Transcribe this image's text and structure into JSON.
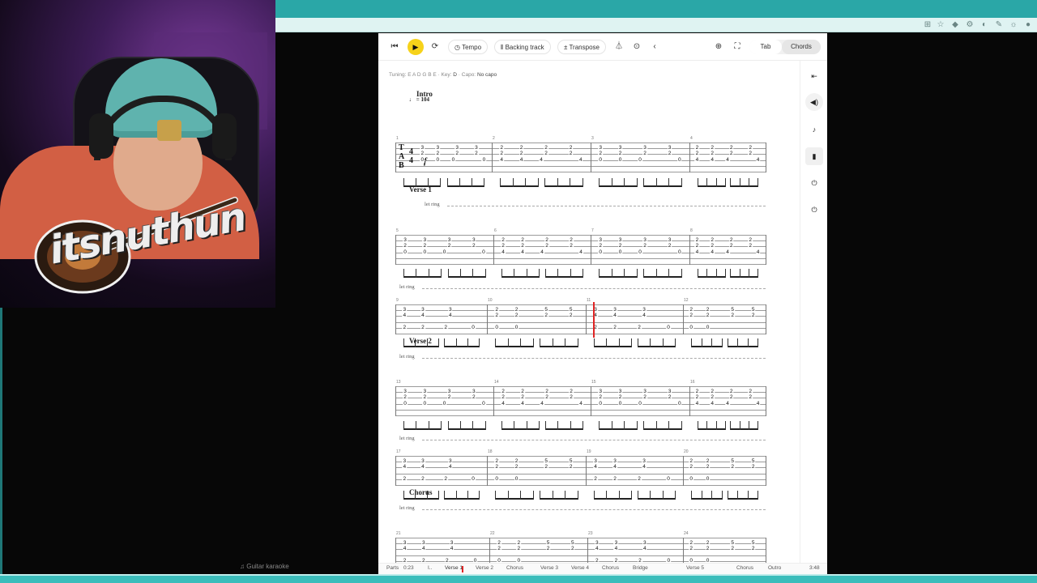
{
  "toolbar": {
    "tempo_label": "Tempo",
    "backing_label": "Backing track",
    "transpose_label": "Transpose",
    "tab_label": "Tab",
    "chords_label": "Chords"
  },
  "info": {
    "tuning_label": "Tuning:",
    "tuning_value": "E A D G B E",
    "key_label": "Key:",
    "key_value": "D",
    "capo_label": "Capo:",
    "capo_value": "No capo"
  },
  "score": {
    "intro_title": "Intro",
    "tempo": "= 104",
    "dynamic": "f",
    "letring": "let ring",
    "verse1_title": "Verse 1",
    "verse2_title": "Verse 2",
    "chorus_title": "Chorus"
  },
  "measures": [
    "1",
    "2",
    "3",
    "4",
    "5",
    "6",
    "7",
    "8",
    "9",
    "10",
    "11",
    "12",
    "13",
    "14",
    "15",
    "16",
    "17",
    "18",
    "19",
    "20",
    "21",
    "22",
    "23",
    "24"
  ],
  "parts": {
    "label": "Parts",
    "time": "0:23",
    "items": [
      "I..",
      "Verse 1",
      "Verse 2",
      "Chorus",
      "Verse 3",
      "Verse 4",
      "Chorus",
      "Bridge",
      "Verse 5",
      "Chorus",
      "Outro"
    ],
    "duration": "3:48"
  },
  "overlay": {
    "logo_text": "itsnuthun",
    "karaoke_label": "Guitar karaoke"
  },
  "colors": {
    "accent_yellow": "#f6d21a",
    "cursor_red": "#e02424",
    "chrome_teal": "#2aa7a7"
  }
}
